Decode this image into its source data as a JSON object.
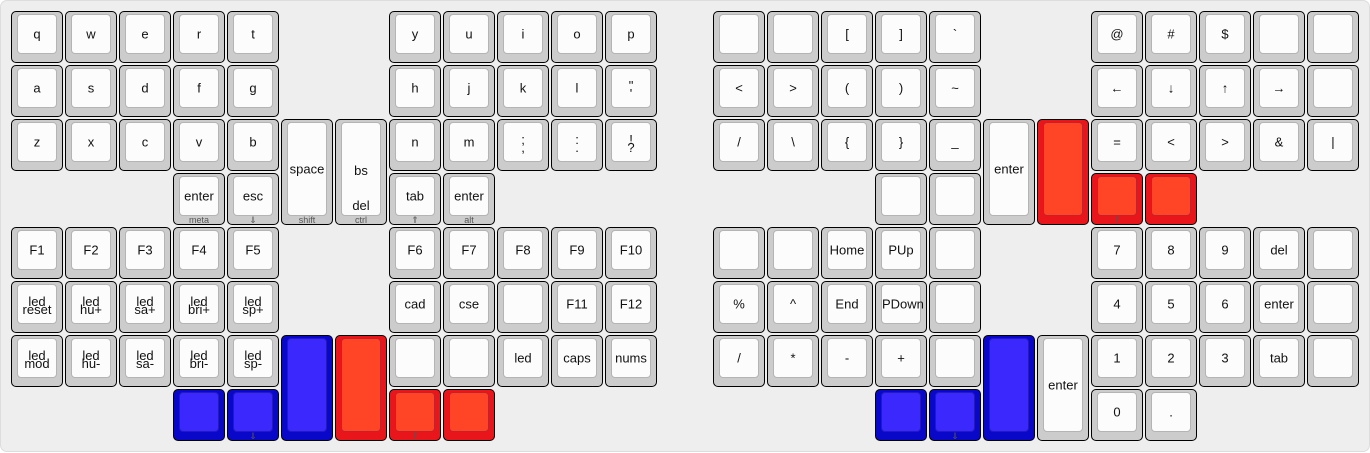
{
  "keyboard": {
    "left_half": [
      {
        "id": "q",
        "label": "q"
      },
      {
        "id": "w",
        "label": "w"
      },
      {
        "id": "e",
        "label": "e"
      },
      {
        "id": "r",
        "label": "r"
      },
      {
        "id": "t",
        "label": "t"
      },
      {
        "id": "y",
        "label": "y"
      },
      {
        "id": "u",
        "label": "u"
      },
      {
        "id": "i",
        "label": "i"
      },
      {
        "id": "o",
        "label": "o"
      },
      {
        "id": "p",
        "label": "p"
      },
      {
        "id": "a",
        "label": "a"
      },
      {
        "id": "s",
        "label": "s"
      },
      {
        "id": "d",
        "label": "d"
      },
      {
        "id": "f",
        "label": "f"
      },
      {
        "id": "g",
        "label": "g"
      },
      {
        "id": "h",
        "label": "h"
      },
      {
        "id": "j",
        "label": "j"
      },
      {
        "id": "k",
        "label": "k"
      },
      {
        "id": "l",
        "label": "l"
      },
      {
        "id": "quote",
        "top": "\"",
        "bottom": "'"
      },
      {
        "id": "z",
        "label": "z"
      },
      {
        "id": "x",
        "label": "x"
      },
      {
        "id": "c",
        "label": "c"
      },
      {
        "id": "v",
        "label": "v"
      },
      {
        "id": "b",
        "label": "b"
      },
      {
        "id": "space",
        "label": "space",
        "front": "shift"
      },
      {
        "id": "bs-del",
        "top": "bs",
        "bottom": "del",
        "front": "ctrl"
      },
      {
        "id": "n",
        "label": "n"
      },
      {
        "id": "m",
        "label": "m"
      },
      {
        "id": "semicolon",
        "top": ";",
        "bottom": ","
      },
      {
        "id": "colon",
        "top": ":",
        "bottom": "."
      },
      {
        "id": "question",
        "top": "!",
        "bottom": "?"
      },
      {
        "id": "enter-meta",
        "label": "enter",
        "front": "meta"
      },
      {
        "id": "esc",
        "label": "esc",
        "front": "⇓"
      },
      {
        "id": "tab",
        "label": "tab",
        "front": "⇑"
      },
      {
        "id": "enter-alt",
        "label": "enter",
        "front": "alt"
      },
      {
        "id": "f1",
        "label": "F1"
      },
      {
        "id": "f2",
        "label": "F2"
      },
      {
        "id": "f3",
        "label": "F3"
      },
      {
        "id": "f4",
        "label": "F4"
      },
      {
        "id": "f5",
        "label": "F5"
      },
      {
        "id": "f6",
        "label": "F6"
      },
      {
        "id": "f7",
        "label": "F7"
      },
      {
        "id": "f8",
        "label": "F8"
      },
      {
        "id": "f9",
        "label": "F9"
      },
      {
        "id": "f10",
        "label": "F10"
      },
      {
        "id": "led-reset",
        "top": "led",
        "bottom": "reset"
      },
      {
        "id": "led-hu-plus",
        "top": "led",
        "bottom": "hu+"
      },
      {
        "id": "led-sa-plus",
        "top": "led",
        "bottom": "sa+"
      },
      {
        "id": "led-bri-plus",
        "top": "led",
        "bottom": "bri+"
      },
      {
        "id": "led-sp-plus",
        "top": "led",
        "bottom": "sp+"
      },
      {
        "id": "cad",
        "label": "cad"
      },
      {
        "id": "cse",
        "label": "cse"
      },
      {
        "id": "blank-l1",
        "label": ""
      },
      {
        "id": "f11",
        "label": "F11"
      },
      {
        "id": "f12",
        "label": "F12"
      },
      {
        "id": "led-mod",
        "top": "led",
        "bottom": "mod"
      },
      {
        "id": "led-hu-minus",
        "top": "led",
        "bottom": "hu-"
      },
      {
        "id": "led-sa-minus",
        "top": "led",
        "bottom": "sa-"
      },
      {
        "id": "led-bri-minus",
        "top": "led",
        "bottom": "bri-"
      },
      {
        "id": "led-sp-minus",
        "top": "led",
        "bottom": "sp-"
      },
      {
        "id": "blue-tall-l",
        "label": "",
        "color": "blue"
      },
      {
        "id": "red-tall-l",
        "label": "",
        "color": "red"
      },
      {
        "id": "blank-l2",
        "label": ""
      },
      {
        "id": "blank-l3",
        "label": ""
      },
      {
        "id": "led",
        "label": "led"
      },
      {
        "id": "caps",
        "label": "caps"
      },
      {
        "id": "nums",
        "label": "nums"
      },
      {
        "id": "blue-l1",
        "label": "",
        "color": "blue"
      },
      {
        "id": "blue-l2",
        "label": "",
        "color": "blue",
        "front": "⇓"
      },
      {
        "id": "red-l1",
        "label": "",
        "color": "red",
        "front": "⇑"
      },
      {
        "id": "red-l2",
        "label": "",
        "color": "red"
      }
    ],
    "right_half": [
      {
        "id": "blank-r1",
        "label": ""
      },
      {
        "id": "blank-r2",
        "label": ""
      },
      {
        "id": "lbracket",
        "label": "["
      },
      {
        "id": "rbracket",
        "label": "]"
      },
      {
        "id": "backtick",
        "label": "`"
      },
      {
        "id": "at",
        "label": "@"
      },
      {
        "id": "hash",
        "label": "#"
      },
      {
        "id": "dollar",
        "label": "$"
      },
      {
        "id": "blank-r3",
        "label": ""
      },
      {
        "id": "blank-r4",
        "label": ""
      },
      {
        "id": "lt1",
        "label": "<"
      },
      {
        "id": "gt1",
        "label": ">"
      },
      {
        "id": "lparen",
        "label": "("
      },
      {
        "id": "rparen",
        "label": ")"
      },
      {
        "id": "tilde",
        "label": "~"
      },
      {
        "id": "arrow-left",
        "label": "←"
      },
      {
        "id": "arrow-down",
        "label": "↓"
      },
      {
        "id": "arrow-up",
        "label": "↑"
      },
      {
        "id": "arrow-right",
        "label": "→"
      },
      {
        "id": "blank-r5",
        "label": ""
      },
      {
        "id": "slash",
        "label": "/"
      },
      {
        "id": "backslash",
        "label": "\\"
      },
      {
        "id": "lbrace",
        "label": "{"
      },
      {
        "id": "rbrace",
        "label": "}"
      },
      {
        "id": "underscore",
        "label": "_"
      },
      {
        "id": "enter-r1",
        "label": "enter"
      },
      {
        "id": "red-tall-r",
        "label": "",
        "color": "red"
      },
      {
        "id": "equals",
        "label": "="
      },
      {
        "id": "lt2",
        "label": "<"
      },
      {
        "id": "gt2",
        "label": ">"
      },
      {
        "id": "ampersand",
        "label": "&"
      },
      {
        "id": "pipe",
        "label": "|"
      },
      {
        "id": "blank-r6",
        "label": ""
      },
      {
        "id": "blank-r7",
        "label": ""
      },
      {
        "id": "red-r1",
        "label": "",
        "color": "red",
        "front": "⇑"
      },
      {
        "id": "red-r2",
        "label": "",
        "color": "red"
      },
      {
        "id": "blank-r8",
        "label": ""
      },
      {
        "id": "blank-r9",
        "label": ""
      },
      {
        "id": "home",
        "label": "Home"
      },
      {
        "id": "pgup",
        "label": "PUp"
      },
      {
        "id": "blank-r10",
        "label": ""
      },
      {
        "id": "num7",
        "label": "7"
      },
      {
        "id": "num8",
        "label": "8"
      },
      {
        "id": "num9",
        "label": "9"
      },
      {
        "id": "del",
        "label": "del"
      },
      {
        "id": "blank-r11",
        "label": ""
      },
      {
        "id": "percent",
        "label": "%"
      },
      {
        "id": "caret",
        "label": "^"
      },
      {
        "id": "end",
        "label": "End"
      },
      {
        "id": "pgdown",
        "label": "PDown"
      },
      {
        "id": "blank-r12",
        "label": ""
      },
      {
        "id": "num4",
        "label": "4"
      },
      {
        "id": "num5",
        "label": "5"
      },
      {
        "id": "num6",
        "label": "6"
      },
      {
        "id": "enter-r2",
        "label": "enter"
      },
      {
        "id": "blank-r13",
        "label": ""
      },
      {
        "id": "divide",
        "label": "/"
      },
      {
        "id": "multiply",
        "label": "*"
      },
      {
        "id": "minus",
        "label": "-"
      },
      {
        "id": "plus",
        "label": "+"
      },
      {
        "id": "blank-r14",
        "label": ""
      },
      {
        "id": "blue-tall-r",
        "label": "",
        "color": "blue"
      },
      {
        "id": "enter-r3",
        "label": "enter"
      },
      {
        "id": "num1",
        "label": "1"
      },
      {
        "id": "num2",
        "label": "2"
      },
      {
        "id": "num3",
        "label": "3"
      },
      {
        "id": "tab-r",
        "label": "tab"
      },
      {
        "id": "blank-r15",
        "label": ""
      },
      {
        "id": "blue-r1",
        "label": "",
        "color": "blue"
      },
      {
        "id": "blue-r2",
        "label": "",
        "color": "blue",
        "front": "⇓"
      },
      {
        "id": "num0",
        "label": "0"
      },
      {
        "id": "dot",
        "label": "."
      }
    ]
  },
  "colors": {
    "layer_red": "#ff4525",
    "layer_blue": "#3b28fc",
    "keycap": "#fcfcfc",
    "key_base": "#cccccc",
    "background": "#eeeeee"
  }
}
